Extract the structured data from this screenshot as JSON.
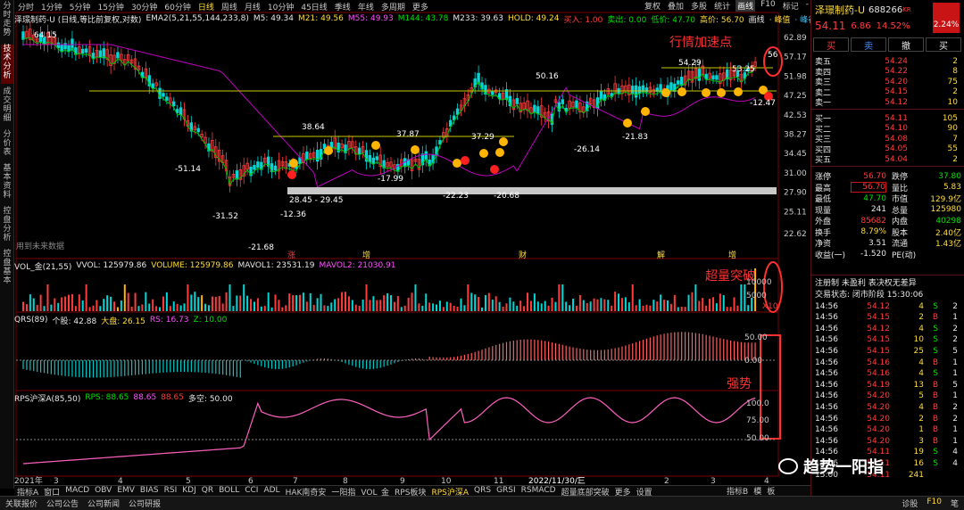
{
  "left_tabs": [
    "分时走势",
    "技术分析",
    "成交明细",
    "分价表",
    "基本资料",
    "控盘分析",
    "控盘基本"
  ],
  "periods": [
    "分时",
    "1分钟",
    "5分钟",
    "15分钟",
    "30分钟",
    "60分钟",
    "日线",
    "周线",
    "月线",
    "10分钟",
    "45日线",
    "季线",
    "年线",
    "多周期",
    "更多"
  ],
  "period_active": "日线",
  "right_tools": [
    "复权",
    "叠加",
    "多股",
    "统计",
    "画线",
    "F10",
    "标记",
    "-"
  ],
  "right_tools_active": "画线",
  "main_info": {
    "name": "泽璟制药-U (日线,等比前复权,对数)",
    "ema": "EMA2(5,21,55,144,233,8)",
    "m5": "M5: 49.34",
    "m21": "M21: 49.56",
    "m55": "M55: 49.93",
    "m144": "M144: 43.78",
    "m233": "M233: 39.63",
    "hold": "HOLD: 49.24",
    "buy": "买入: 1.00",
    "sell": "卖出: 0.00",
    "low": "低价: 47.70",
    "high": "高价: 56.70",
    "line1": "画线",
    "line2": "· 峰值",
    "line3": "· 峰谷"
  },
  "price_axis": [
    "62.89",
    "57.17",
    "51.98",
    "47.25",
    "42.53",
    "38.27",
    "34.45",
    "31.00",
    "27.90",
    "25.11",
    "22.62"
  ],
  "price_labels": [
    "64.15",
    "38.64",
    "37.87",
    "37.29",
    "50.16",
    "54.29",
    "53.25",
    "56",
    "-51.14",
    "-17.99",
    "-22.23",
    "-20.68",
    "-26.14",
    "-21.83",
    "-12.47",
    "-31.52",
    "-12.36",
    "-21.68",
    "28.45 - 29.45"
  ],
  "future_note": "用到未来数据",
  "events": [
    "涨",
    "增",
    "财",
    "解",
    "增"
  ],
  "annot_1": "行情加速点",
  "annot_2": "超量突破",
  "annot_3": "强势",
  "vol_info": {
    "a": "VOL_金(21,55)",
    "b": "VVOL: 125979.86",
    "c": "VOLUME: 125979.86",
    "d": "MAVOL1: 23531.19",
    "e": "MAVOL2: 21030.91"
  },
  "vol_axis": [
    "10000",
    "5000",
    "X10"
  ],
  "qrs_info": {
    "a": "QRS(89)",
    "b": "个股: 42.88",
    "c": "大盘: 26.15",
    "d": "RS: 16.73",
    "e": "Z: 10.00"
  },
  "qrs_axis": [
    "50.00",
    "0.00"
  ],
  "rps_info": {
    "a": "RPS沪深A(85,50)",
    "b": "RPS: 88.65",
    "c": "88.65",
    "d": "88.65",
    "e": "多空: 50.00"
  },
  "rps_axis": [
    "100.0",
    "75.00",
    "50.00"
  ],
  "x_labels": [
    "2021年",
    "3",
    "4",
    "5",
    "6",
    "7",
    "8",
    "9",
    "10",
    "11",
    "2022/11/30/三",
    "1",
    "2",
    "3",
    "4"
  ],
  "indicators": [
    "指标A",
    "窗口",
    "MACD",
    "OBV",
    "EMV",
    "BIAS",
    "RSI",
    "KDJ",
    "QR",
    "BOLL",
    "CCI",
    "ADL",
    "HAK南奇安",
    "一阳指",
    "VOL_金",
    "RPS板块",
    "RPS沪深A",
    "QRS",
    "GRSI",
    "RSMACD",
    "超量底部突破",
    "更多",
    "设置"
  ],
  "ind_active": "RPS沪深A",
  "ind_right": [
    "指标B",
    "模",
    "板"
  ],
  "status": [
    "关联报价",
    "公司公告",
    "公司新闻",
    "公司研报"
  ],
  "status_right": [
    "诊股",
    "F10",
    "笔"
  ],
  "stock": {
    "name": "泽璟制药-U",
    "code": "688266",
    "tag": "KR",
    "price": "54.11",
    "chg": "6.86",
    "pct": "14.52%",
    "side_pct": "2.24%"
  },
  "trade_btns": [
    "买",
    "卖",
    "撤",
    "买"
  ],
  "asks": [
    {
      "l": "卖五",
      "p": "54.24",
      "v": "2"
    },
    {
      "l": "卖四",
      "p": "54.22",
      "v": "8"
    },
    {
      "l": "卖三",
      "p": "54.20",
      "v": "75"
    },
    {
      "l": "卖二",
      "p": "54.15",
      "v": "2"
    },
    {
      "l": "卖一",
      "p": "54.12",
      "v": "10"
    }
  ],
  "bids": [
    {
      "l": "买一",
      "p": "54.11",
      "v": "105"
    },
    {
      "l": "买二",
      "p": "54.10",
      "v": "90"
    },
    {
      "l": "买三",
      "p": "54.08",
      "v": "7"
    },
    {
      "l": "买四",
      "p": "54.05",
      "v": "55"
    },
    {
      "l": "买五",
      "p": "54.04",
      "v": "2"
    }
  ],
  "stats": [
    [
      "涨停",
      "56.70",
      "跌停",
      "37.80"
    ],
    [
      "最高",
      "56.70",
      "量比",
      "5.83"
    ],
    [
      "最低",
      "47.70",
      "市值",
      "129.9亿"
    ],
    [
      "现量",
      "241",
      "总量",
      "125980"
    ],
    [
      "外盘",
      "85682",
      "内盘",
      "40298"
    ],
    [
      "换手",
      "8.79%",
      "股本",
      "2.40亿"
    ],
    [
      "净资",
      "3.51",
      "流通",
      "1.43亿"
    ],
    [
      "收益(一)",
      "-1.520",
      "PE(动)",
      ""
    ]
  ],
  "reg_line": "注册制  未盈利  表决权无差异",
  "trade_state": "交易状态: 闭市阶段 15:30:06",
  "ticks": [
    [
      "14:56",
      "54.12",
      "4",
      "S",
      "2"
    ],
    [
      "14:56",
      "54.15",
      "2",
      "B",
      "1"
    ],
    [
      "14:56",
      "54.12",
      "4",
      "S",
      "2"
    ],
    [
      "14:56",
      "54.15",
      "10",
      "S",
      "2"
    ],
    [
      "14:56",
      "54.15",
      "25",
      "S",
      "5"
    ],
    [
      "14:56",
      "54.16",
      "4",
      "B",
      "1"
    ],
    [
      "14:56",
      "54.16",
      "4",
      "S",
      "1"
    ],
    [
      "14:56",
      "54.19",
      "13",
      "B",
      "5"
    ],
    [
      "14:56",
      "54.20",
      "5",
      "B",
      "1"
    ],
    [
      "14:56",
      "54.20",
      "4",
      "B",
      "2"
    ],
    [
      "14:56",
      "54.20",
      "2",
      "B",
      "2"
    ],
    [
      "14:56",
      "54.20",
      "1",
      "B",
      "1"
    ],
    [
      "14:56",
      "54.20",
      "3",
      "B",
      "1"
    ],
    [
      "14:56",
      "54.11",
      "19",
      "S",
      "4"
    ],
    [
      "14:56",
      "54.11",
      "16",
      "S",
      "4"
    ],
    [
      "15:00",
      "54.11",
      "241",
      "",
      ""
    ]
  ],
  "watermark": "趋势一阳指"
}
